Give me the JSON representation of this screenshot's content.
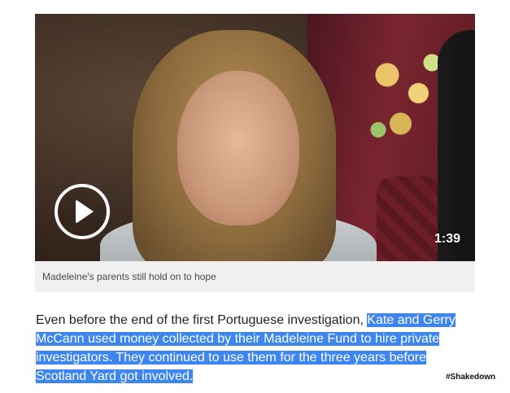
{
  "video": {
    "duration": "1:39",
    "caption": "Madeleine's parents still hold on to hope",
    "play_icon": "play-icon"
  },
  "article": {
    "plain_text": "Even before the end of the first Portuguese investigation, ",
    "highlighted_text": "Kate and Gerry McCann used money collected by their Madeleine Fund to hire private investigators. They continued to use them for the three years before Scotland Yard got involved.",
    "hashtag": "#Shakedown"
  },
  "colors": {
    "highlight": "#3d86f0",
    "caption_bg": "#f0f0f0"
  }
}
